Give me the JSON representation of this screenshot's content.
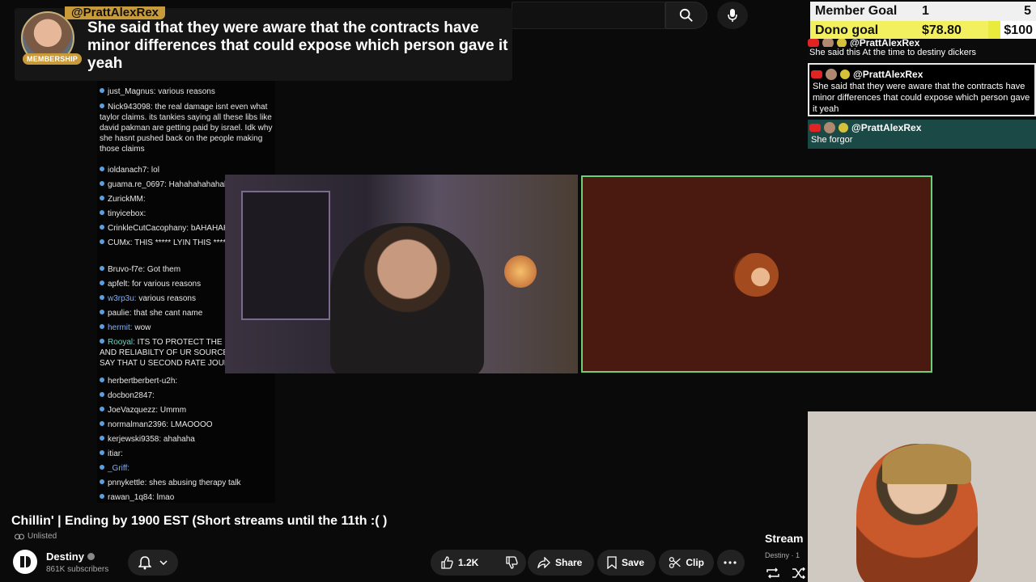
{
  "search": {
    "placeholder": ""
  },
  "banner": {
    "username": "@PrattAlexRex",
    "badge": "MEMBERSHIP",
    "message": "She said that they were aware that the contracts have minor differences that could expose which person gave it yeah"
  },
  "chat": [
    {
      "user": "just_Magnus:",
      "text": " various reasons"
    },
    {
      "user": "Nick943098:",
      "text": " the real damage isnt even what taylor claims. its tankies saying all these libs like david pakman are getting paid by israel. Idk why she hasnt pushed back on the people making those claims"
    },
    {
      "user": "ioldanach7:",
      "text": " lol"
    },
    {
      "user": "guama.re_0697:",
      "text": " Hahahahahahaha"
    },
    {
      "user": "ZurickMM:",
      "text": ""
    },
    {
      "user": "tinyicebox:",
      "text": ""
    },
    {
      "user": "CrinkleCutCacophany:",
      "text": " bAHAHAHAHAHA"
    },
    {
      "user": "CUMx:",
      "text": " THIS ***** LYIN  THIS ***** LYIN"
    },
    {
      "user": "Bruvo-f7e:",
      "text": " Got them"
    },
    {
      "user": "apfelt:",
      "text": " for various reasons"
    },
    {
      "user": "w3rp3u:",
      "text": " various reasons"
    },
    {
      "user": "paulie:",
      "text": " that she cant name"
    },
    {
      "user": "hermit:",
      "text": " wow"
    },
    {
      "user": "Rooyal:",
      "text": " ITS TO PROTECT THE INTEGRITY AND RELIABILTY OF UR SOURCES  JUST SAY THAT U SECOND RATE JOURNALIST"
    },
    {
      "user": "herbertberbert-u2h:",
      "text": ""
    },
    {
      "user": "docbon2847:",
      "text": ""
    },
    {
      "user": "JoeVazquezz:",
      "text": " Ummm"
    },
    {
      "user": "normalman2396:",
      "text": " LMAOOOO"
    },
    {
      "user": "kerjewski9358:",
      "text": " ahahaha"
    },
    {
      "user": "itiar:",
      "text": ""
    },
    {
      "user": "_Griff:",
      "text": ""
    },
    {
      "user": "pnnykettle:",
      "text": " shes abusing therapy talk"
    },
    {
      "user": "rawan_1q84:",
      "text": " lmao"
    }
  ],
  "goals": {
    "member_label": "Member Goal",
    "member_value": "1",
    "member_max": "5",
    "dono_label": "Dono goal",
    "dono_value": "$78.80",
    "dono_max": "$100",
    "dono_progress": 0.788
  },
  "side_messages": [
    {
      "user": "@PrattAlexRex",
      "text": "She said this At the time to destiny dickers"
    },
    {
      "user": "@PrattAlexRex",
      "text": "She said that they were aware that the contracts have minor differences that could expose which person gave it yeah"
    },
    {
      "user": "@PrattAlexRex",
      "text": "She forgor"
    }
  ],
  "video": {
    "title": "Chillin' | Ending by 1900 EST (Short streams until the 11th :( )",
    "visibility": "Unlisted",
    "channel": "Destiny",
    "subscribers": "861K subscribers"
  },
  "actions": {
    "likes": "1.2K",
    "share": "Share",
    "save": "Save",
    "clip": "Clip"
  },
  "stream_panel": {
    "title": "Stream",
    "subtitle": "Destiny · 1"
  },
  "colors": {
    "accent_gold": "#c99a3a",
    "game_border": "#6ad07a",
    "dono_bar": "#e9ec3a"
  }
}
